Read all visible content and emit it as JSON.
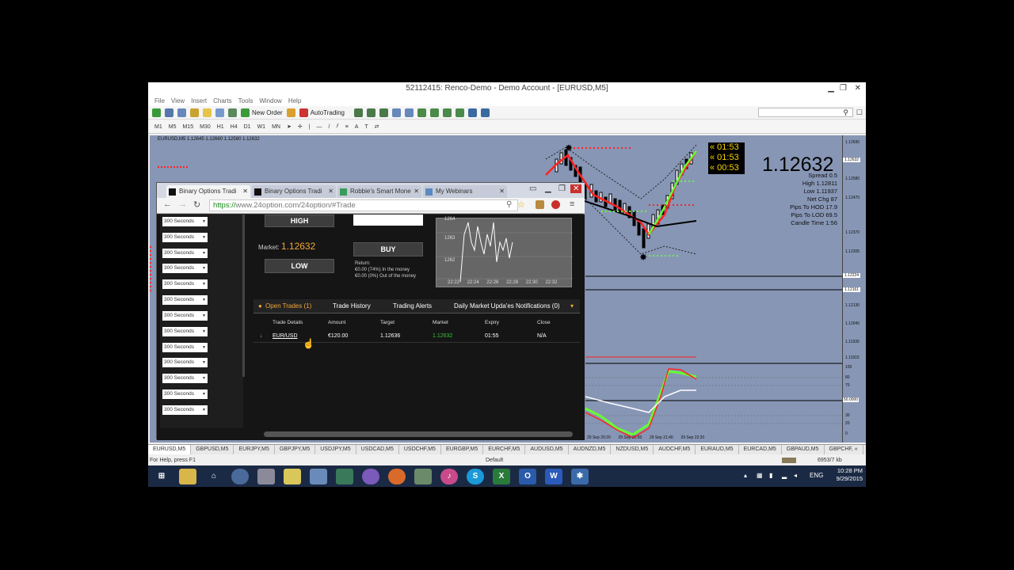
{
  "mt4": {
    "window_title": "52112415: Renco-Demo - Demo Account - [EURUSD,M5]",
    "menu": [
      "File",
      "View",
      "Insert",
      "Charts",
      "Tools",
      "Window",
      "Help"
    ],
    "toolbar": {
      "new_order": "New Order",
      "autotrading": "AutoTrading"
    },
    "timeframes": [
      "M1",
      "M5",
      "M15",
      "M30",
      "H1",
      "H4",
      "D1",
      "W1",
      "MN"
    ],
    "chart_header": "EURUSD,M5  1.12645 1.12660 1.12580 1.12632",
    "big_price": "1.12632",
    "timers": [
      "« 01:53",
      "« 01:53",
      "« 00:53"
    ],
    "stats": [
      {
        "label": "Spread",
        "value": "0.5"
      },
      {
        "label": "High",
        "value": "1.12811"
      },
      {
        "label": "Low",
        "value": "1.11937"
      },
      {
        "label": "Net Chg",
        "value": "87"
      },
      {
        "label": "Pips To HOD",
        "value": "17.9"
      },
      {
        "label": "Pips To LOD",
        "value": "69.5"
      },
      {
        "label": "Candle Time",
        "value": "1:56"
      }
    ],
    "price_ticks": [
      "1.12695",
      "1.12632",
      "1.12580",
      "1.12470",
      "1.12370",
      "1.12305",
      "1.12224",
      "1.12161",
      "1.12130",
      "1.12045",
      "1.11930",
      "1.11915"
    ],
    "osc_ticks": [
      "100",
      "80",
      "70",
      "50.0000",
      "30",
      "20",
      "0"
    ],
    "time_ticks": [
      "29 Sep 20:20",
      "29 Sep 21:00",
      "29 Sep 21:40",
      "29 Sep 22:20"
    ],
    "symbol_tabs": [
      "EURUSD,M5",
      "GBPUSD,M5",
      "EURJPY,M5",
      "GBPJPY,M5",
      "USDJPY,M5",
      "USDCAD,M5",
      "USDCHF,M5",
      "EURGBP,M5",
      "EURCHF,M5",
      "AUDUSD,M5",
      "AUDNZD,M5",
      "NZDUSD,M5",
      "AUDCHF,M5",
      "EURAUD,M5",
      "EURCAD,M5",
      "GBPAUD,M5",
      "GBPCHF, «"
    ],
    "status_help": "For Help, press F1",
    "status_profile": "Default",
    "status_kb": "6953/7 kb"
  },
  "browser": {
    "tabs": [
      "Binary Options Tradi",
      "Binary Options Tradi",
      "Robbie's Smart Mone",
      "My Webinars"
    ],
    "url_scheme": "https://",
    "url_rest": "www.24option.com/24option/#Trade",
    "expiry_option": "300 Seconds",
    "high_label": "HIGH",
    "low_label": "LOW",
    "buy_label": "BUY",
    "market_label": "Market:",
    "market_value": "1.12632",
    "return_label": "Return:",
    "return_in": "€0.00 (74%) In the money",
    "return_out": "€0.00 (0%) Out of the money",
    "mini_chart_ticks": [
      "1264",
      "1263",
      "1262"
    ],
    "mini_time_ticks": [
      "22:22",
      "22:24",
      "22:26",
      "22:28",
      "22:30",
      "22:32"
    ],
    "trade_tabs": [
      "Open Trades (1)",
      "Trade History",
      "Trading Alerts",
      "Daily Market Upda'es Notifications (0)"
    ],
    "table_headers": [
      "Trade Details",
      "Amount",
      "Target",
      "Market",
      "Expiry",
      "Close"
    ],
    "table_row": [
      "EUR/USD",
      "€120.00",
      "1.12636",
      "1.12632",
      "01:55",
      "N/A"
    ]
  },
  "taskbar": {
    "lang": "ENG",
    "time": "10:28 PM",
    "date": "9/29/2015"
  },
  "colors": {
    "accent": "#f3a736",
    "chart_bg": "#8796b5",
    "up": "#66ff33",
    "down": "#ff2222"
  }
}
